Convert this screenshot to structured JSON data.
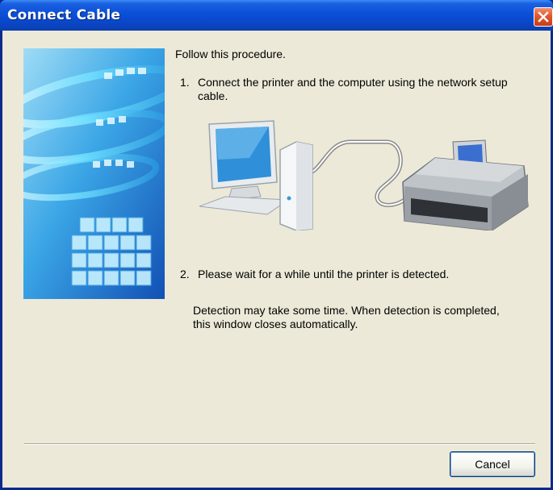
{
  "window": {
    "title": "Connect Cable",
    "close_icon": "close-icon"
  },
  "instructions": {
    "intro": "Follow this procedure.",
    "step1_number": "1.",
    "step1_text_line1": "Connect the printer and the computer using the network setup",
    "step1_text_line2": "cable.",
    "step2_number": "2.",
    "step2_text": "Please wait for a while until the printer is detected.",
    "note_line1": "Detection may take some time. When detection is completed,",
    "note_line2": "this window closes automatically."
  },
  "buttons": {
    "cancel_label": "Cancel"
  },
  "illustration": {
    "computer": "desktop-computer-icon",
    "cable": "network-cable-icon",
    "printer": "printer-icon"
  },
  "colors": {
    "titlebar": "#0b4fd8",
    "dialog_bg": "#ece9d8",
    "close_button": "#e2582e"
  }
}
